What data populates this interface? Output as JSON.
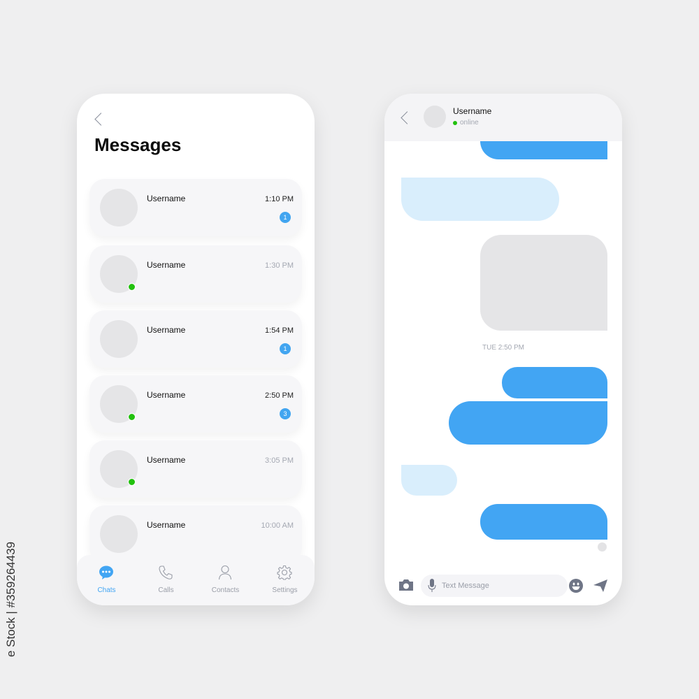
{
  "left_screen": {
    "title": "Messages",
    "back_icon": "chevron-left-icon",
    "conversations": [
      {
        "name": "Username",
        "time": "1:10 PM",
        "online": false,
        "unread": "1",
        "time_color": "#222222"
      },
      {
        "name": "Username",
        "time": "1:30 PM",
        "online": true,
        "unread": null,
        "time_color": "#a4a8b2"
      },
      {
        "name": "Username",
        "time": "1:54 PM",
        "online": false,
        "unread": "1",
        "time_color": "#222222"
      },
      {
        "name": "Username",
        "time": "2:50 PM",
        "online": true,
        "unread": "3",
        "time_color": "#222222"
      },
      {
        "name": "Username",
        "time": "3:05 PM",
        "online": true,
        "unread": null,
        "time_color": "#a4a8b2"
      },
      {
        "name": "Username",
        "time": "10:00 AM",
        "online": false,
        "unread": null,
        "time_color": "#a4a8b2"
      }
    ],
    "tabs": [
      {
        "label": "Chats",
        "icon": "chat-bubble-icon",
        "active": true
      },
      {
        "label": "Calls",
        "icon": "phone-icon",
        "active": false
      },
      {
        "label": "Contacts",
        "icon": "person-icon",
        "active": false
      },
      {
        "label": "Settings",
        "icon": "gear-icon",
        "active": false
      }
    ]
  },
  "right_screen": {
    "contact_name": "Username",
    "status": "online",
    "timestamp": "TUE 2:50 PM",
    "input_placeholder": "Text Message",
    "icons": [
      "camera-icon",
      "microphone-icon",
      "emoji-icon",
      "send-icon"
    ]
  },
  "colors": {
    "accent": "#42a5f3",
    "incoming_bubble": "#d9eefc",
    "online": "#22c10e",
    "muted": "#a4a8b2"
  },
  "watermark": "e Stock | #359264439"
}
